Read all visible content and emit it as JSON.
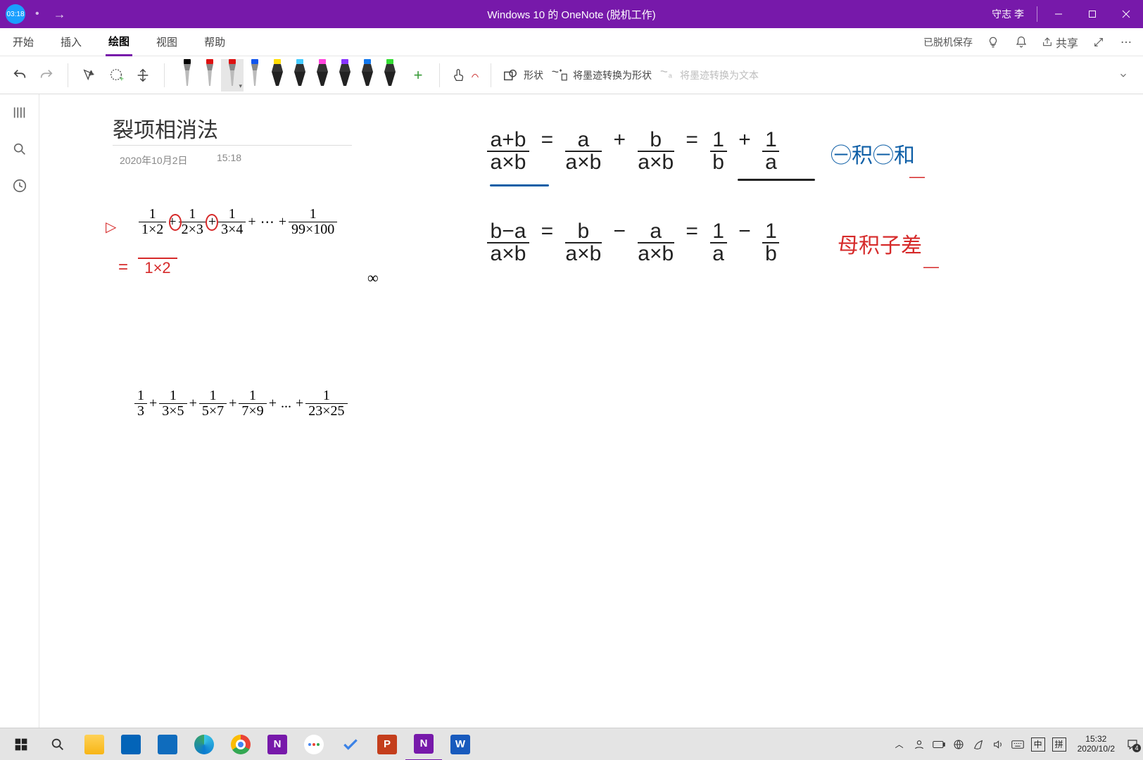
{
  "window": {
    "sync_badge": "03:18",
    "title": "Windows 10 的 OneNote (脱机工作)",
    "username": "守志 李"
  },
  "menu": {
    "tabs": [
      "开始",
      "插入",
      "绘图",
      "视图",
      "帮助"
    ],
    "active_index": 2,
    "status": "已脱机保存",
    "share": "共享"
  },
  "ribbon": {
    "shape": "形状",
    "ink_to_shape": "将墨迹转换为形状",
    "ink_to_text": "将墨迹转换为文本",
    "pens": [
      {
        "tip": "#000",
        "body": "#888",
        "kind": "pen"
      },
      {
        "tip": "#d11",
        "body": "#888",
        "kind": "pen"
      },
      {
        "tip": "#d11",
        "body": "#888",
        "kind": "pen",
        "active": true
      },
      {
        "tip": "#15e",
        "body": "#888",
        "kind": "pen"
      },
      {
        "tip": "#fd0",
        "body": "#333",
        "kind": "high"
      },
      {
        "tip": "#4cf",
        "body": "#333",
        "kind": "high"
      },
      {
        "tip": "#f4d",
        "body": "#333",
        "kind": "high"
      },
      {
        "tip": "#83f",
        "body": "#333",
        "kind": "high"
      },
      {
        "tip": "#17e",
        "body": "#333",
        "kind": "high"
      },
      {
        "tip": "#3d3",
        "body": "#333",
        "kind": "high"
      }
    ]
  },
  "page": {
    "title": "裂项相消法",
    "date": "2020年10月2日",
    "time": "15:18"
  },
  "expr1": {
    "terms": [
      {
        "n": "1",
        "d": "1×2"
      },
      {
        "n": "1",
        "d": "2×3"
      },
      {
        "n": "1",
        "d": "3×4"
      }
    ],
    "last": {
      "n": "1",
      "d": "99×100"
    },
    "plus": "+",
    "dots": "⋯"
  },
  "expr2": {
    "first": {
      "n": "1",
      "d": "3"
    },
    "terms": [
      {
        "n": "1",
        "d": "3×5"
      },
      {
        "n": "1",
        "d": "5×7"
      },
      {
        "n": "1",
        "d": "7×9"
      }
    ],
    "last": {
      "n": "1",
      "d": "23×25"
    },
    "plus": "+",
    "dots": "..."
  },
  "handwriting": {
    "triangle": "▷",
    "eq_step": "=",
    "eq_step_denom": "1×2",
    "infinity": "∞",
    "line1": "(a+b)/(a×b) = a/(a×b) + b/(a×b) = 1/b + 1/a",
    "note1": "㊀积㊀和",
    "note1_sub": "—",
    "line2": "(b−a)/(a×b) = b/(a×b) − a/(a×b) = 1/a − 1/b",
    "note2": "母积子差",
    "note2_sub": "—"
  },
  "taskbar": {
    "ime1": "中",
    "ime2": "拼",
    "clock_time": "15:32",
    "clock_date": "2020/10/2",
    "notif_count": "4"
  }
}
